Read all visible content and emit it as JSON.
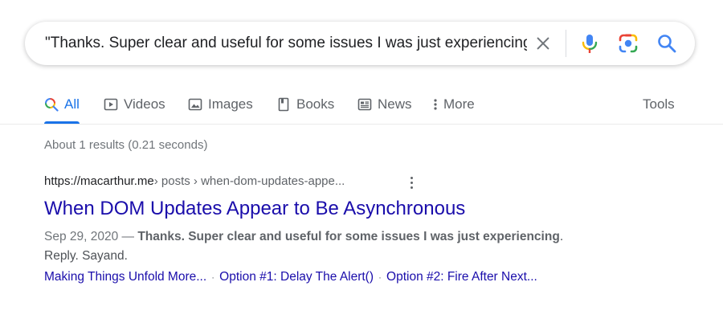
{
  "search": {
    "query": "\"Thanks. Super clear and useful for some issues I was just experiencing"
  },
  "icons": {
    "clear": "close-icon",
    "mic": "microphone-icon",
    "camera": "lens-camera-icon",
    "search": "search-icon"
  },
  "colors": {
    "accent": "#1a73e8",
    "link": "#1a0dab",
    "mic_blue": "#4285f4",
    "mic_red": "#ea4335",
    "mic_yellow": "#fbbc04",
    "mic_green": "#34a853"
  },
  "tabs": [
    {
      "label": "All",
      "icon": "search-icon",
      "active": true
    },
    {
      "label": "Videos",
      "icon": "play-icon"
    },
    {
      "label": "Images",
      "icon": "image-icon"
    },
    {
      "label": "Books",
      "icon": "book-icon"
    },
    {
      "label": "News",
      "icon": "newspaper-icon"
    },
    {
      "label": "More",
      "icon": "more-vert-icon"
    }
  ],
  "tools_label": "Tools",
  "stats": "About 1 results (0.21 seconds)",
  "result": {
    "site": "https://macarthur.me",
    "crumbs": " › posts › when-dom-updates-appe...",
    "title": "When DOM Updates Appear to Be Asynchronous",
    "date": "Sep 29, 2020 — ",
    "snippet_bold": "Thanks. Super clear and useful for some issues I was just experiencing",
    "snippet_after": ".",
    "snippet_line2": "Reply. Sayand.",
    "sitelinks": [
      "Making Things Unfold More...",
      "Option #1: Delay The Alert()",
      "Option #2: Fire After Next..."
    ]
  }
}
